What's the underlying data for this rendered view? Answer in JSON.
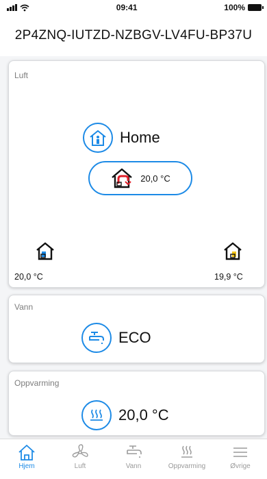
{
  "status_bar": {
    "time": "09:41",
    "battery": "100%"
  },
  "header": {
    "device_id": "2P4ZNQ-IUTZD-NZBGV-LV4FU-BP37U"
  },
  "luft": {
    "label": "Luft",
    "mode": "Home",
    "setpoint": "20,0 °C",
    "indoor_left_temp": "20,0 °C",
    "indoor_right_temp": "19,9 °C"
  },
  "vann": {
    "label": "Vann",
    "mode": "ECO"
  },
  "oppvarming": {
    "label": "Oppvarming",
    "temp": "20,0 °C"
  },
  "tabs": [
    {
      "label": "Hjem",
      "icon": "home-icon"
    },
    {
      "label": "Luft",
      "icon": "fan-icon"
    },
    {
      "label": "Vann",
      "icon": "faucet-icon"
    },
    {
      "label": "Oppvarming",
      "icon": "heating-icon"
    },
    {
      "label": "Øvrige",
      "icon": "menu-icon"
    }
  ],
  "colors": {
    "accent": "#1c8ae6",
    "red": "#e0202a",
    "yellow": "#f2c418"
  }
}
